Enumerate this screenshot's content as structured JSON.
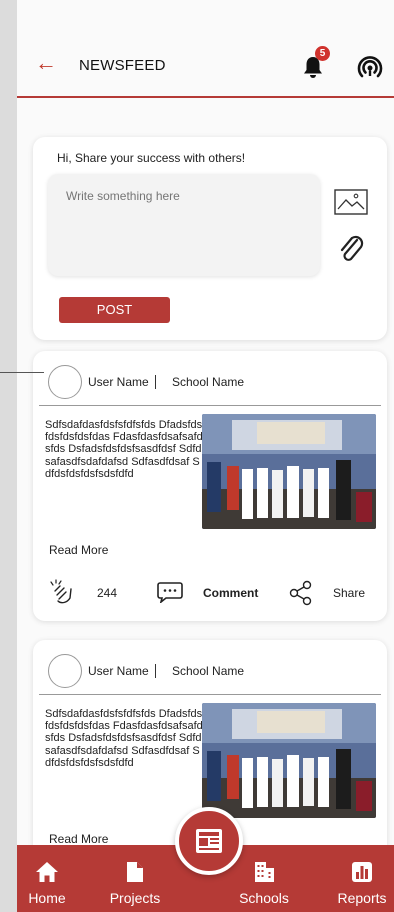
{
  "header": {
    "title": "NEWSFEED",
    "notification_count": "5",
    "back_icon": "arrow-left-icon",
    "bell_icon": "bell-icon",
    "broadcast_icon": "broadcast-icon"
  },
  "composer": {
    "title": "Hi, Share your success with others!",
    "placeholder": "Write something here",
    "post_label": "POST"
  },
  "posts": [
    {
      "user_name": "User Name",
      "school_name": "School Name",
      "text": "Sdfsdafdasfdsfsfdfsfds Dfadsfdsfdsfdsfdsfdas Fdasfdasfdsafsafdsfds Dsfadsfdsfdsfsasdfdsf Sdfdsafasdfsdafdafsd Sdfasdfdsaf Sdfdsfdsfdsfsdsfdfd",
      "read_more": "Read More",
      "clap_count": "244",
      "comment_label": "Comment",
      "share_label": "Share"
    },
    {
      "user_name": "User Name",
      "school_name": "School Name",
      "text": "Sdfsdafdasfdsfsfdfsfds Dfadsfdsfdsfdsfdsfdas Fdasfdasfdsafsafdsfds Dsfadsfdsfdsfsasdfdsf Sdfdsafasdfsdafdafsd Sdfasdfdsaf Sdfdsfdsfdsfsdsfdfd",
      "read_more": "Read More"
    }
  ],
  "nav": {
    "home": "Home",
    "projects": "Projects",
    "schools": "Schools",
    "reports": "Reports",
    "center_icon": "newspaper-icon"
  },
  "colors": {
    "accent": "#b53a36",
    "badge": "#d0322d",
    "background": "#fafafa"
  }
}
